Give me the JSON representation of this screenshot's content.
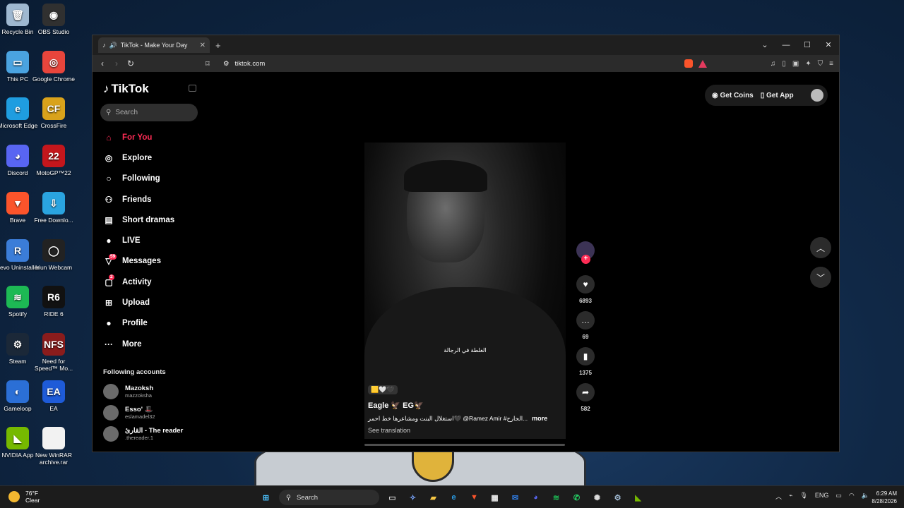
{
  "desktop_icons": [
    {
      "label": "Recycle Bin",
      "icon": "recycle-bin-icon",
      "color": "#9fb8d0",
      "glyph": "🗑"
    },
    {
      "label": "OBS Studio",
      "icon": "obs-icon",
      "color": "#303030",
      "glyph": "◉"
    },
    {
      "label": "This PC",
      "icon": "monitor-icon",
      "color": "#4aa3e0",
      "glyph": "▭"
    },
    {
      "label": "Google Chrome",
      "icon": "chrome-icon",
      "color": "#e8453c",
      "glyph": "◎"
    },
    {
      "label": "Microsoft Edge",
      "icon": "edge-icon",
      "color": "#1f9de0",
      "glyph": "e"
    },
    {
      "label": "CrossFire",
      "icon": "crossfire-icon",
      "color": "#d9a21b",
      "glyph": "CF"
    },
    {
      "label": "Discord",
      "icon": "discord-icon",
      "color": "#5865f2",
      "glyph": "◕"
    },
    {
      "label": "MotoGP™22",
      "icon": "motogp-icon",
      "color": "#c4161c",
      "glyph": "22"
    },
    {
      "label": "Brave",
      "icon": "brave-icon",
      "color": "#fb542b",
      "glyph": "▼"
    },
    {
      "label": "Free Downlo...",
      "icon": "fdm-icon",
      "color": "#2aa4e0",
      "glyph": "⇩"
    },
    {
      "label": "Revo Uninstaller",
      "icon": "revo-icon",
      "color": "#3b7dd8",
      "glyph": "R"
    },
    {
      "label": "Iriun Webcam",
      "icon": "webcam-icon",
      "color": "#222222",
      "glyph": "◯"
    },
    {
      "label": "Spotify",
      "icon": "spotify-icon",
      "color": "#1db954",
      "glyph": "≋"
    },
    {
      "label": "RIDE 6",
      "icon": "ride6-icon",
      "color": "#111111",
      "glyph": "R6"
    },
    {
      "label": "Steam",
      "icon": "steam-icon",
      "color": "#1b2838",
      "glyph": "⚙"
    },
    {
      "label": "Need for Speed™ Mo...",
      "icon": "nfs-icon",
      "color": "#8a1c1c",
      "glyph": "NFS"
    },
    {
      "label": "Gameloop",
      "icon": "gameloop-icon",
      "color": "#2b6fd6",
      "glyph": "◐"
    },
    {
      "label": "EA",
      "icon": "ea-icon",
      "color": "#1e5bd8",
      "glyph": "EA"
    },
    {
      "label": "NVIDIA App",
      "icon": "nvidia-icon",
      "color": "#76b900",
      "glyph": "◣"
    },
    {
      "label": "New WinRAR archive.rar",
      "icon": "file-icon",
      "color": "#f2f2f2",
      "glyph": ""
    }
  ],
  "browser": {
    "tab_title": "TikTok - Make Your Day",
    "url": "tiktok.com"
  },
  "tiktok": {
    "logo": "TikTok",
    "search_placeholder": "Search",
    "nav": [
      {
        "label": "For You",
        "icon": "home-icon",
        "glyph": "⌂",
        "active": true
      },
      {
        "label": "Explore",
        "icon": "compass-icon",
        "glyph": "◎"
      },
      {
        "label": "Following",
        "icon": "following-ring-icon",
        "glyph": "○"
      },
      {
        "label": "Friends",
        "icon": "friends-icon",
        "glyph": "⚇"
      },
      {
        "label": "Short dramas",
        "icon": "film-icon",
        "glyph": "▤"
      },
      {
        "label": "LIVE",
        "icon": "live-icon",
        "glyph": "●"
      },
      {
        "label": "Messages",
        "icon": "messages-icon",
        "glyph": "▽",
        "badge": "59"
      },
      {
        "label": "Activity",
        "icon": "activity-icon",
        "glyph": "▢",
        "badge": "2"
      },
      {
        "label": "Upload",
        "icon": "upload-icon",
        "glyph": "⊞"
      },
      {
        "label": "Profile",
        "icon": "profile-avatar-icon",
        "glyph": "●"
      },
      {
        "label": "More",
        "icon": "more-dots-icon",
        "glyph": "···"
      }
    ],
    "following_title": "Following accounts",
    "accounts": [
      {
        "name": "Mazoksh",
        "handle": "mazzoksha"
      },
      {
        "name": "Esso' 🎩",
        "handle": "eslamadel32"
      },
      {
        "name": "القارئ - The reader",
        "handle": ".thereader.1"
      }
    ],
    "get_coins": "Get Coins",
    "get_app": "Get App",
    "video": {
      "subtitle": "الغلطة في الرجالة",
      "emojis": "🟨🤍🖤",
      "author": "Eagle 🦅 EG🦅",
      "caption": "استغلال البنت ومشاعرها خط احمر🖤 @Ramez Amir #الجارح...",
      "more": "more",
      "see_translation": "See translation"
    },
    "actions": {
      "likes": "6893",
      "comments": "69",
      "saves": "1375",
      "shares": "582"
    }
  },
  "taskbar": {
    "temp": "76°F",
    "weather": "Clear",
    "search": "Search",
    "lang": "ENG",
    "time": "6:29 AM",
    "date": "8/28/2026"
  }
}
